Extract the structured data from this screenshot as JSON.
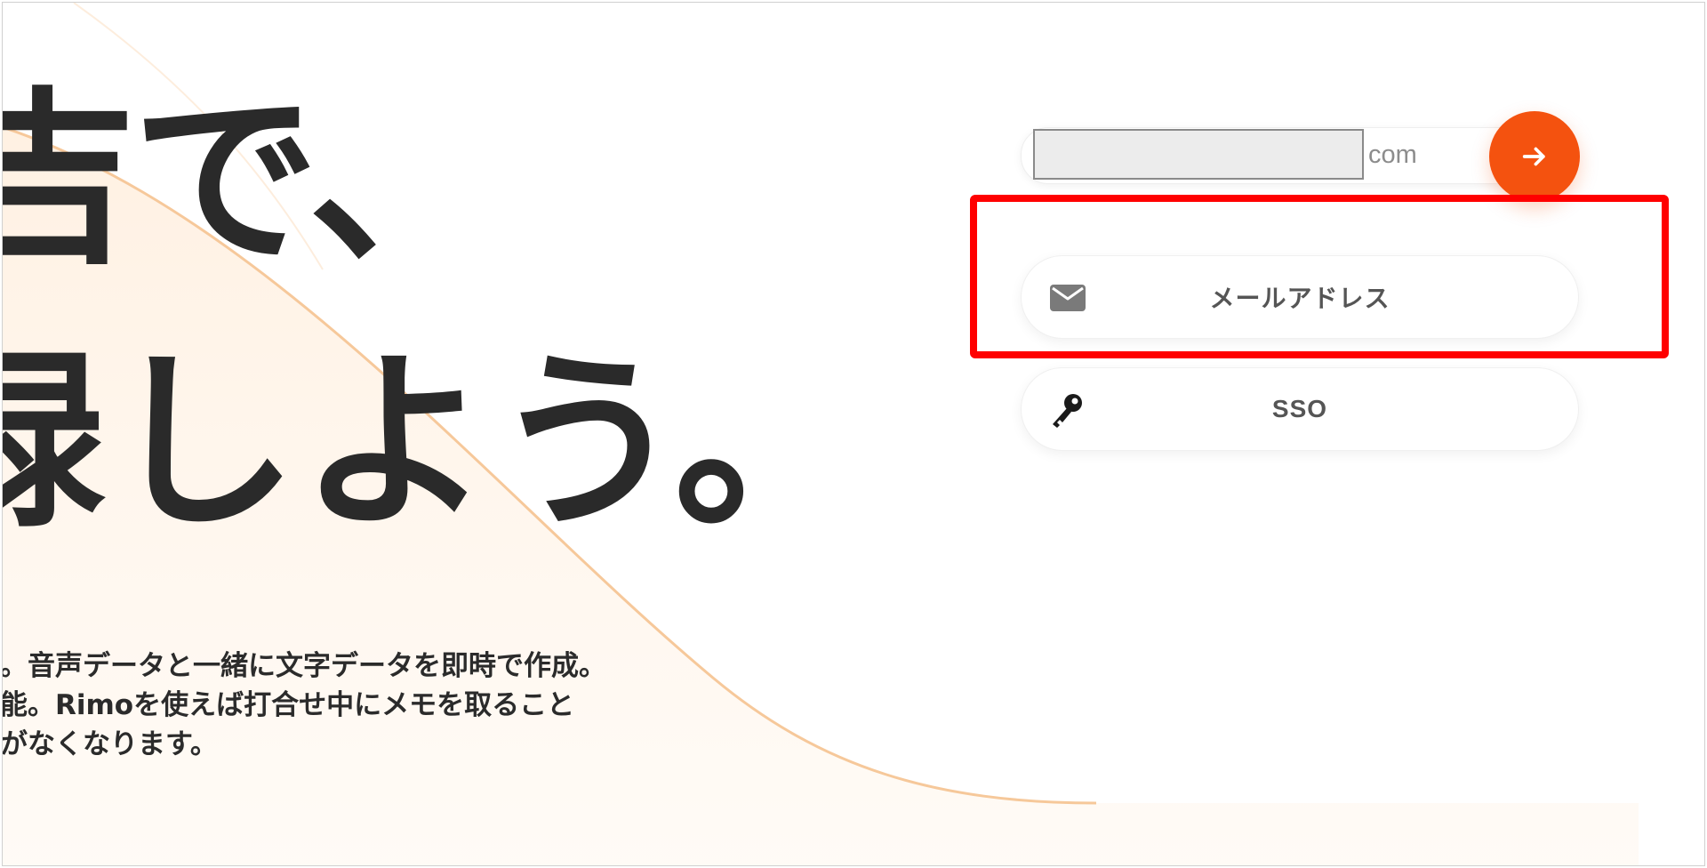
{
  "hero": {
    "line1": "吉で、",
    "line2": "録しよう。"
  },
  "description": {
    "lines": [
      "と。音声データと一緒に文字データを即時で作成。",
      "可能。Rimoを使えば打合せ中にメモを取ること",
      "とがなくなります。"
    ]
  },
  "login": {
    "email_value": "",
    "email_suffix": "com",
    "submit_icon": "arrow-right-icon",
    "buttons": {
      "mail_label": "メールアドレス",
      "mail_icon": "envelope-icon",
      "sso_label": "SSO",
      "sso_icon": "key-icon"
    }
  },
  "colors": {
    "accent": "#f4520f",
    "highlight": "#ff0000",
    "wave_stroke": "#f6c89a",
    "wave_fill": "#fff3e6",
    "text_dark": "#2a2a2a",
    "text_muted": "#555555"
  }
}
